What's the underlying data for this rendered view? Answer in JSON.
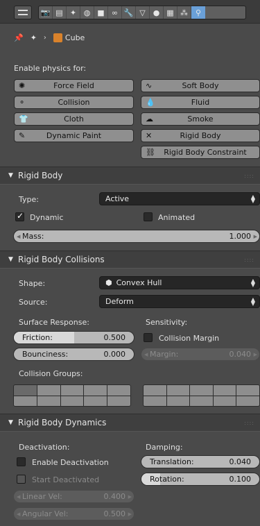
{
  "toolbar": {
    "icons": [
      "render-icon",
      "render-layers-icon",
      "scene-icon",
      "world-icon",
      "object-icon",
      "constraints-icon",
      "modifiers-icon",
      "data-icon",
      "material-icon",
      "texture-icon",
      "particles-icon",
      "physics-icon"
    ]
  },
  "breadcrumb": {
    "object": "Cube"
  },
  "enable_physics": {
    "title": "Enable physics for:",
    "left": [
      "Force Field",
      "Collision",
      "Cloth",
      "Dynamic Paint"
    ],
    "right": [
      "Soft Body",
      "Fluid",
      "Smoke",
      "Rigid Body",
      "Rigid Body Constraint"
    ]
  },
  "rigid_body": {
    "header": "Rigid Body",
    "type_label": "Type:",
    "type_value": "Active",
    "dynamic_label": "Dynamic",
    "dynamic_checked": true,
    "animated_label": "Animated",
    "animated_checked": false,
    "mass_label": "Mass:",
    "mass_value": "1.000"
  },
  "collisions": {
    "header": "Rigid Body Collisions",
    "shape_label": "Shape:",
    "shape_value": "Convex Hull",
    "source_label": "Source:",
    "source_value": "Deform",
    "surface_response": "Surface Response:",
    "sensitivity": "Sensitivity:",
    "friction_label": "Friction:",
    "friction_value": "0.500",
    "friction_fill": 0.5,
    "bounciness_label": "Bounciness:",
    "bounciness_value": "0.000",
    "collision_margin_label": "Collision Margin",
    "margin_label": "Margin:",
    "margin_value": "0.040",
    "collision_groups": "Collision Groups:"
  },
  "dynamics": {
    "header": "Rigid Body Dynamics",
    "deactivation": "Deactivation:",
    "damping": "Damping:",
    "enable_deactivation": "Enable Deactivation",
    "start_deactivated": "Start Deactivated",
    "translation_label": "Translation:",
    "translation_value": "0.040",
    "rotation_label": "Rotation:",
    "rotation_value": "0.100",
    "linear_vel_label": "Linear Vel:",
    "linear_vel_value": "0.400",
    "angular_vel_label": "Angular Vel:",
    "angular_vel_value": "0.500"
  },
  "colors": {
    "accent": "#6aa0d8",
    "cube": "#d9822b"
  }
}
